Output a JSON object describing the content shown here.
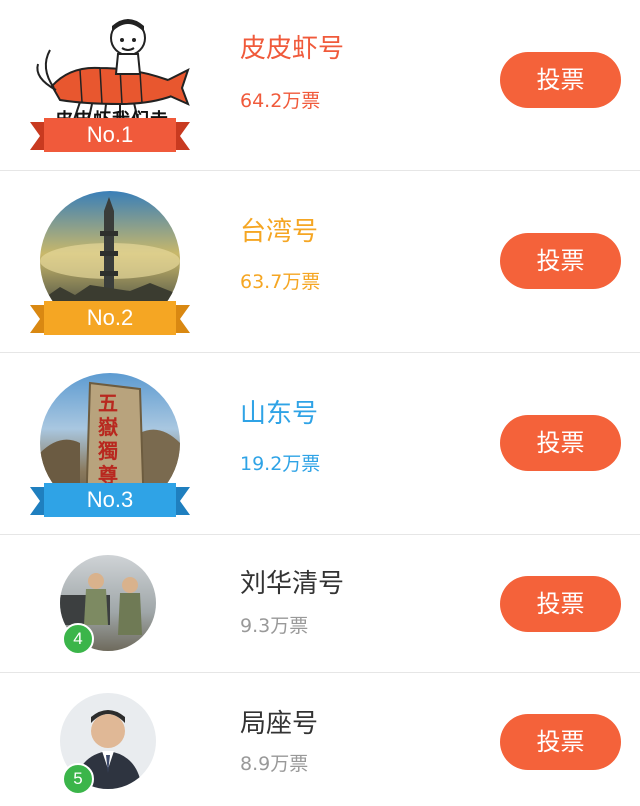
{
  "colors": {
    "accent": "#f4623a",
    "rank1": "#f05a3b",
    "rank2": "#f5a623",
    "rank3": "#2fa3e6",
    "rank_other_badge": "#3bb54a",
    "secondary_text": "#999999",
    "primary_text": "#333333"
  },
  "items": [
    {
      "name": "皮皮虾号",
      "votes": "64.2万票",
      "rank_label": "No.1",
      "button_label": "投票",
      "image_caption": "皮皮虾我们走"
    },
    {
      "name": "台湾号",
      "votes": "63.7万票",
      "rank_label": "No.2",
      "button_label": "投票"
    },
    {
      "name": "山东号",
      "votes": "19.2万票",
      "rank_label": "No.3",
      "button_label": "投票",
      "image_caption": "五嶽獨尊"
    },
    {
      "name": "刘华清号",
      "votes": "9.3万票",
      "rank_label": "4",
      "button_label": "投票"
    },
    {
      "name": "局座号",
      "votes": "8.9万票",
      "rank_label": "5",
      "button_label": "投票"
    }
  ]
}
